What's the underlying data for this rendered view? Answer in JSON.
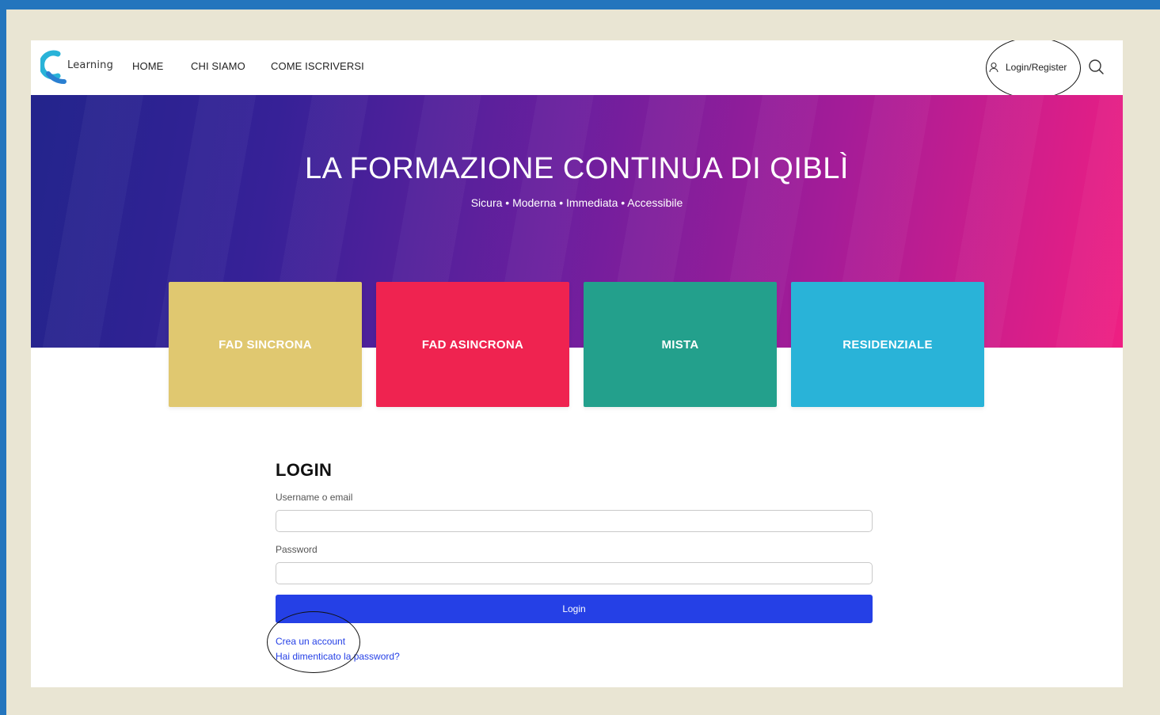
{
  "header": {
    "logo_text": "Learning",
    "nav": [
      {
        "label": "HOME"
      },
      {
        "label": "CHI SIAMO"
      },
      {
        "label": "COME ISCRIVERSI"
      }
    ],
    "login_register": "Login/Register",
    "icons": {
      "user": "user-icon",
      "search": "search-icon"
    }
  },
  "hero": {
    "title": "LA FORMAZIONE CONTINUA DI QIBLÌ",
    "subtitle": "Sicura • Moderna • Immediata • Accessibile"
  },
  "cards": [
    {
      "label": "FAD SINCRONA",
      "color": "#e0c870"
    },
    {
      "label": "FAD ASINCRONA",
      "color": "#ef2350"
    },
    {
      "label": "MISTA",
      "color": "#23a08c"
    },
    {
      "label": "RESIDENZIALE",
      "color": "#29b3d8"
    }
  ],
  "login": {
    "title": "LOGIN",
    "username_label": "Username o email",
    "username_value": "",
    "password_label": "Password",
    "password_value": "",
    "button_label": "Login",
    "create_account": "Crea un account",
    "forgot_password": "Hai dimenticato la password?"
  },
  "colors": {
    "frame_blue": "#2475bd",
    "background": "#e9e5d3",
    "login_button": "#2540e6",
    "link": "#2540e6"
  }
}
